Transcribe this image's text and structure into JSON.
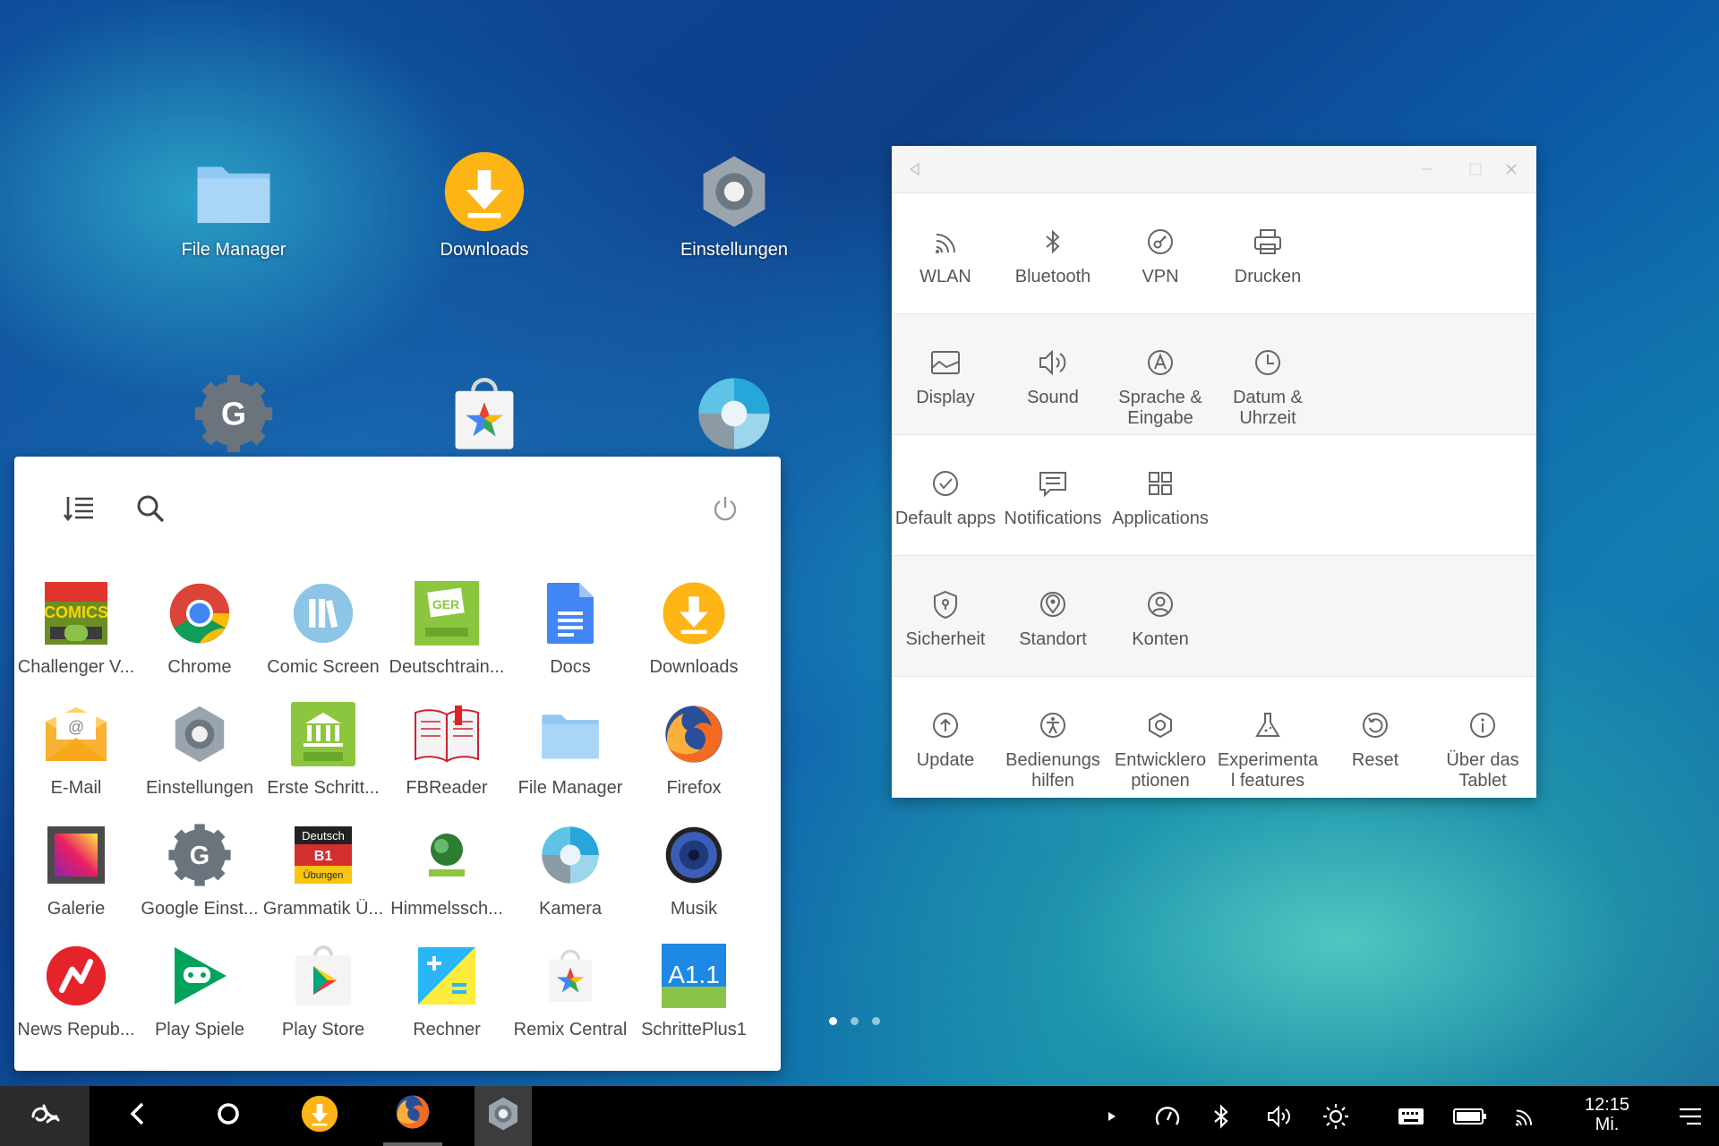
{
  "desktop": {
    "icons": [
      {
        "label": "File Manager",
        "icon": "folder-icon"
      },
      {
        "label": "Downloads",
        "icon": "download-icon"
      },
      {
        "label": "Einstellungen",
        "icon": "settings-gear-icon"
      },
      {
        "label": "",
        "icon": "google-settings-icon"
      },
      {
        "label": "",
        "icon": "remix-central-icon"
      },
      {
        "label": "",
        "icon": "camera-lens-icon"
      }
    ],
    "page_indicator": {
      "count": 3,
      "active": 1
    }
  },
  "app_drawer": {
    "sort_icon": "sort-list-icon",
    "search_icon": "search-icon",
    "power_icon": "power-icon",
    "apps": [
      {
        "label": "Challenger V...",
        "icon": "comics-viewer-icon"
      },
      {
        "label": "Chrome",
        "icon": "chrome-icon"
      },
      {
        "label": "Comic Screen",
        "icon": "comic-screen-icon"
      },
      {
        "label": "Deutschtrain...",
        "icon": "deutschtrainer-icon"
      },
      {
        "label": "Docs",
        "icon": "docs-icon"
      },
      {
        "label": "Downloads",
        "icon": "download-icon"
      },
      {
        "label": "E-Mail",
        "icon": "email-icon"
      },
      {
        "label": "Einstellungen",
        "icon": "settings-gear-icon"
      },
      {
        "label": "Erste Schritt...",
        "icon": "goethe-institut-icon"
      },
      {
        "label": "FBReader",
        "icon": "book-icon"
      },
      {
        "label": "File Manager",
        "icon": "folder-icon"
      },
      {
        "label": "Firefox",
        "icon": "firefox-icon"
      },
      {
        "label": "Galerie",
        "icon": "gallery-icon"
      },
      {
        "label": "Google Einst...",
        "icon": "google-settings-icon"
      },
      {
        "label": "Grammatik Ü...",
        "icon": "grammatik-icon"
      },
      {
        "label": "Himmelssch...",
        "icon": "globe-icon"
      },
      {
        "label": "Kamera",
        "icon": "camera-lens-icon"
      },
      {
        "label": "Musik",
        "icon": "speaker-icon"
      },
      {
        "label": "News Repub...",
        "icon": "news-republic-icon"
      },
      {
        "label": "Play Spiele",
        "icon": "play-games-icon"
      },
      {
        "label": "Play Store",
        "icon": "play-store-icon"
      },
      {
        "label": "Rechner",
        "icon": "calculator-icon"
      },
      {
        "label": "Remix Central",
        "icon": "remix-central-icon"
      },
      {
        "label": "SchrittePlus1",
        "icon": "schritteplus-icon"
      }
    ],
    "schritte_badge": "A1.1",
    "grammatik_badge": {
      "top": "Deutsch",
      "mid": "B1",
      "bottom": "Übungen"
    },
    "ger_badge": "GER"
  },
  "settings_window": {
    "titlebar": {
      "back_icon": "back-triangle-icon",
      "minimize_icon": "minimize-icon",
      "maximize_icon": "maximize-icon",
      "close_icon": "close-icon"
    },
    "rows": [
      {
        "items": [
          {
            "label": "WLAN",
            "icon": "wifi-icon"
          },
          {
            "label": "Bluetooth",
            "icon": "bluetooth-icon"
          },
          {
            "label": "VPN",
            "icon": "vpn-icon"
          },
          {
            "label": "Drucken",
            "icon": "printer-icon"
          }
        ]
      },
      {
        "items": [
          {
            "label": "Display",
            "icon": "display-icon"
          },
          {
            "label": "Sound",
            "icon": "sound-icon"
          },
          {
            "label": "Sprache & Eingabe",
            "icon": "language-icon"
          },
          {
            "label": "Datum & Uhrzeit",
            "icon": "clock-icon"
          }
        ]
      },
      {
        "items": [
          {
            "label": "Default apps",
            "icon": "check-circle-icon"
          },
          {
            "label": "Notifications",
            "icon": "notification-icon"
          },
          {
            "label": "Applications",
            "icon": "apps-grid-icon"
          }
        ]
      },
      {
        "items": [
          {
            "label": "Sicherheit",
            "icon": "shield-icon"
          },
          {
            "label": "Standort",
            "icon": "location-icon"
          },
          {
            "label": "Konten",
            "icon": "account-icon"
          }
        ]
      },
      {
        "items": [
          {
            "label": "Update",
            "icon": "update-icon"
          },
          {
            "label": "Bedienungs hilfen",
            "icon": "accessibility-icon"
          },
          {
            "label": "Entwicklero ptionen",
            "icon": "developer-icon"
          },
          {
            "label": "Experimenta l features",
            "icon": "flask-icon"
          },
          {
            "label": "Reset",
            "icon": "reset-icon"
          },
          {
            "label": "Über das Tablet",
            "icon": "info-icon"
          }
        ]
      }
    ]
  },
  "taskbar": {
    "start_icon": "remix-logo-icon",
    "nav": {
      "back_icon": "back-icon",
      "home_icon": "home-icon"
    },
    "pinned": [
      {
        "icon": "download-icon"
      },
      {
        "icon": "firefox-icon"
      },
      {
        "icon": "settings-gear-icon"
      }
    ],
    "tray": [
      "expand-arrow-icon",
      "speed-icon",
      "bluetooth-icon",
      "volume-icon",
      "brightness-icon",
      "keyboard-icon",
      "battery-icon",
      "wifi-icon"
    ],
    "clock": {
      "time": "12:15",
      "day": "Mi."
    },
    "notifications_icon": "notifications-menu-icon"
  }
}
